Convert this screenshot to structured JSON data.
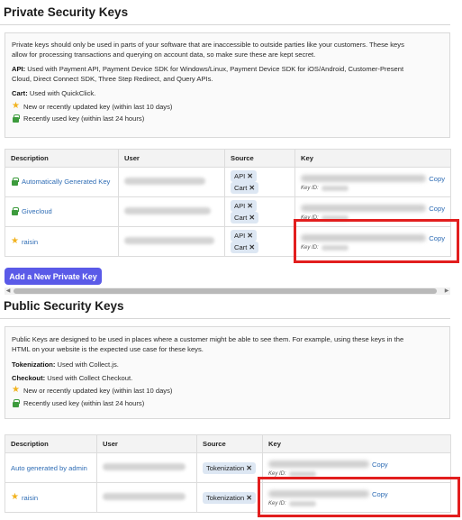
{
  "private": {
    "title": "Private Security Keys",
    "intro_line1": "Private keys should only be used in parts of your software that are inaccessible to outside parties like your customers. These keys",
    "intro_line2": "allow for processing transactions and querying on account data, so make sure these are kept secret.",
    "api_label": "API:",
    "api_line1": " Used with Payment API, Payment Device SDK for Windows/Linux, Payment Device SDK for iOS/Android, Customer-Present",
    "api_line2": "Cloud, Direct Connect SDK, Three Step Redirect, and Query APIs.",
    "cart_label": "Cart:",
    "cart_text": " Used with QuickClick.",
    "legend_new": "New or recently updated key (within last 10 days)",
    "legend_recent": "Recently used key (within last 24 hours)",
    "table": {
      "headers": [
        "Description",
        "User",
        "Source",
        "Key"
      ],
      "rows": [
        {
          "description": "Automatically Generated Key",
          "icon": "recent-key-icon",
          "tags": [
            "API",
            "Cart"
          ],
          "copy": "Copy",
          "key_id_label": "Key ID:"
        },
        {
          "description": "Givecloud",
          "icon": "recent-key-icon",
          "tags": [
            "API",
            "Cart"
          ],
          "copy": "Copy",
          "key_id_label": "Key ID:"
        },
        {
          "description": "raisin",
          "icon": "star-icon",
          "tags": [
            "API",
            "Cart"
          ],
          "copy": "Copy",
          "key_id_label": "Key ID:"
        }
      ]
    },
    "add_button": "Add a New Private Key"
  },
  "public": {
    "title": "Public Security Keys",
    "intro_line1": "Public Keys are designed to be used in places where a customer might be able to see them. For example, using these keys in the",
    "intro_line2": "HTML on your website is the expected use case for these keys.",
    "tokenization_label": "Tokenization:",
    "tokenization_text": " Used with Collect.js.",
    "checkout_label": "Checkout:",
    "checkout_text": " Used with Collect Checkout.",
    "legend_new": "New or recently updated key (within last 10 days)",
    "legend_recent": "Recently used key (within last 24 hours)",
    "table": {
      "headers": [
        "Description",
        "User",
        "Source",
        "Key"
      ],
      "rows": [
        {
          "description": "Auto generated by admin",
          "icon": "",
          "tags": [
            "Tokenization"
          ],
          "copy": "Copy",
          "key_id_label": "Key ID:"
        },
        {
          "description": "raisin",
          "icon": "star-icon",
          "tags": [
            "Tokenization"
          ],
          "copy": "Copy",
          "key_id_label": "Key ID:"
        }
      ]
    }
  },
  "colors": {
    "link": "#2f6db5",
    "button": "#5a5ae8",
    "highlight": "#e21e1e",
    "tag_bg": "#dde7f3",
    "star": "#f1b320",
    "recent_key": "#3d9b3d"
  }
}
